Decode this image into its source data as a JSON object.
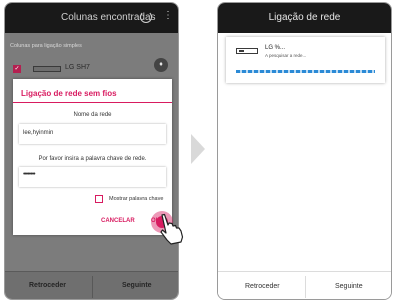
{
  "left_screen": {
    "header": {
      "title": "Colunas encontradas",
      "refresh_icon": "refresh-icon",
      "menu_icon": "more-vert-icon"
    },
    "subtitle": "Colunas para ligação simples",
    "speaker_item": {
      "name": "LG SH7",
      "checked": true
    },
    "footer": {
      "back_label": "Retroceder",
      "next_label": "Seguinte"
    },
    "dialog": {
      "title": "Ligação de rede sem fios",
      "network_name_label": "Nome da rede",
      "network_name_value": "lee,hyinmin",
      "password_label": "Por favor insira a palavra chave de rede.",
      "password_value": "••••••••",
      "show_password_label": "Mostrar palavra chave",
      "cancel_label": "CANCELAR",
      "ok_label": "OK"
    },
    "accent_color": "#d81b60"
  },
  "right_screen": {
    "header": {
      "title": "Ligação de rede"
    },
    "speaker_card": {
      "name": "LG %...",
      "status": "A pesquisar a rede..."
    },
    "footer": {
      "back_label": "Retroceder",
      "next_label": "Seguinte"
    },
    "progress_color": "#2b8ad6"
  }
}
